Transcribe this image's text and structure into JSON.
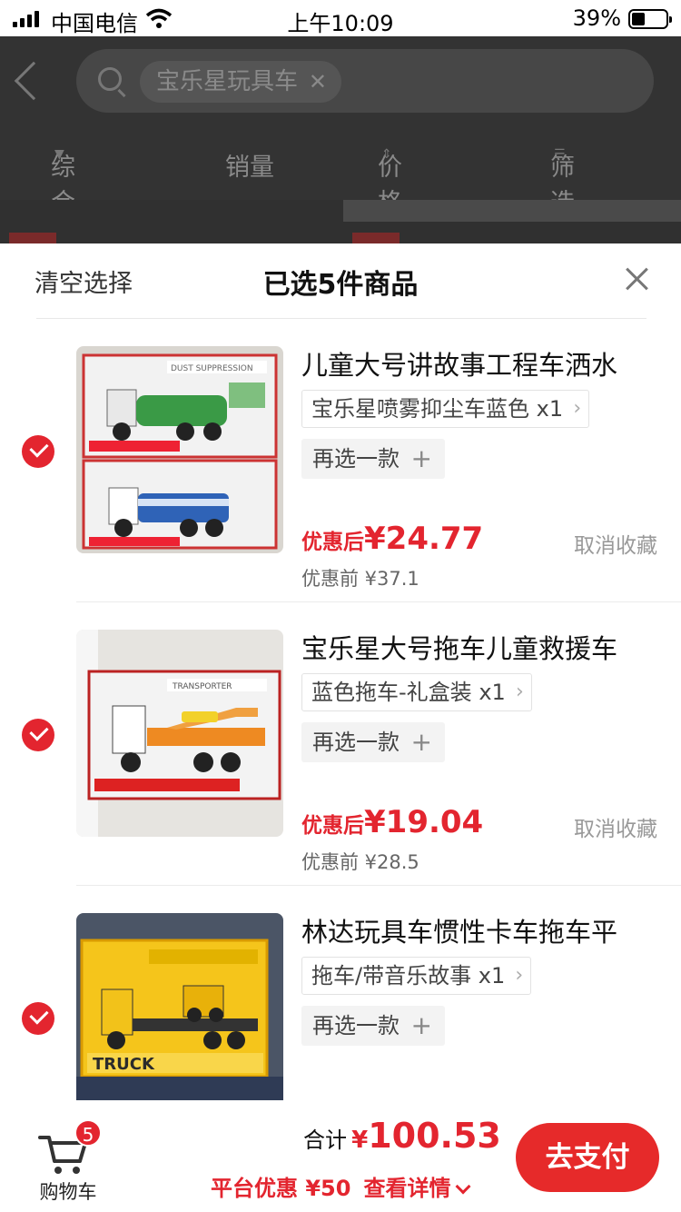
{
  "status_bar": {
    "carrier": "中国电信",
    "time": "上午10:09",
    "battery": "39%"
  },
  "search": {
    "query": "宝乐星玩具车"
  },
  "sort_tabs": [
    "综合",
    "销量",
    "价格",
    "筛选"
  ],
  "sheet": {
    "clear_label": "清空选择",
    "title": "已选5件商品"
  },
  "items": [
    {
      "name": "儿童大号讲故事工程车洒水",
      "variant": "宝乐星喷雾抑尘车蓝色",
      "qty": "x1",
      "reselect": "再选一款",
      "price_label": "优惠后",
      "price": "¥24.77",
      "original_price": "优惠前 ¥37.1",
      "cancel_fav": "取消收藏",
      "image": {
        "box_label": "DUST SUPPRESSION",
        "accent": "#2e9e4a"
      }
    },
    {
      "name": "宝乐星大号拖车儿童救援车",
      "variant": "蓝色拖车-礼盒装",
      "qty": "x1",
      "reselect": "再选一款",
      "price_label": "优惠后",
      "price": "¥19.04",
      "original_price": "优惠前 ¥28.5",
      "cancel_fav": "取消收藏",
      "image": {
        "box_label": "TRANSPORTER",
        "accent": "#f08a1c"
      }
    },
    {
      "name": "林达玩具车惯性卡车拖车平",
      "variant": "拖车/带音乐故事",
      "qty": "x1",
      "reselect": "再选一款",
      "price_label": "",
      "price": "",
      "original_price": "",
      "cancel_fav": "",
      "image": {
        "box_label": "TRUCK",
        "accent": "#f2c21a"
      }
    }
  ],
  "bottom_bar": {
    "cart_label": "购物车",
    "cart_count": "5",
    "total_label": "合计",
    "currency": "¥",
    "total_amount": "100.53",
    "discount": "平台优惠 ¥50",
    "discount_detail": "查看详情",
    "pay_label": "去支付"
  },
  "colors": {
    "accent_red": "#e3252f",
    "pay_button": "#e62a2a"
  }
}
